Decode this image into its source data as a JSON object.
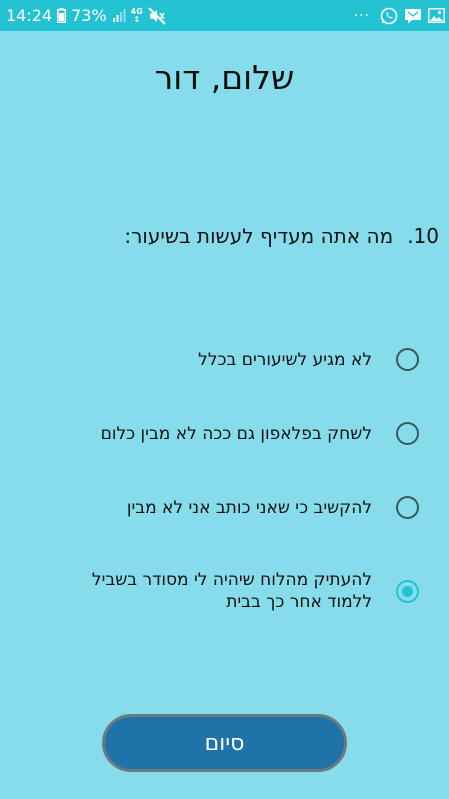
{
  "status_bar": {
    "time": "14:24",
    "battery_percent": "73%",
    "network": "4G",
    "dots": "···",
    "icons": [
      "battery-icon",
      "signal-icon",
      "network-icon",
      "mute-icon",
      "whatsapp-icon",
      "message-icon",
      "gallery-icon"
    ]
  },
  "colors": {
    "background": "#86dcea",
    "status_bar": "#24c3d4",
    "button": "#1e73a8",
    "radio_selected": "#21c1d6"
  },
  "header": {
    "title": "שלום, דור"
  },
  "question": {
    "number": "10.",
    "text": "מה אתה מעדיף לעשות בשיעור:"
  },
  "options": [
    {
      "label": "לא מגיע לשיעורים בכלל",
      "selected": false
    },
    {
      "label": "לשחק בפלאפון גם ככה לא מבין כלום",
      "selected": false
    },
    {
      "label": "להקשיב כי שאני כותב אני לא מבין",
      "selected": false
    },
    {
      "label": "להעתיק מהלוח שיהיה לי מסודר בשביל ללמוד אחר כך בבית",
      "selected": true
    }
  ],
  "finish_button": {
    "label": "סיום"
  }
}
